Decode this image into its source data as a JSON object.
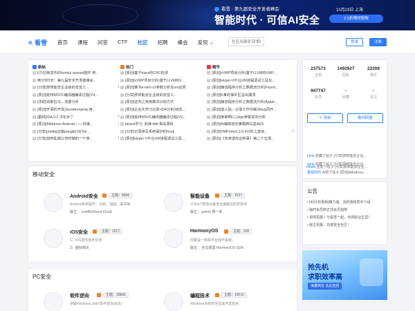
{
  "banner": {
    "event": "看雪 · 第九届安全开发者峰会",
    "slogan": "智能时代 · 可信AI安全",
    "date": "10月23日 上海",
    "cta": "2.5折限时抢购"
  },
  "nav": {
    "logo": "看雪",
    "items": [
      "首页",
      "课程",
      "问答",
      "CTF",
      "社区",
      "招聘",
      "峰会",
      "发现"
    ],
    "active": "社区",
    "search_placeholder": "社区关键词 回车",
    "login": "登录",
    "register": "注册"
  },
  "hot": {
    "columns": [
      {
        "title": "新帖",
        "icon_color": "#2d7cf3",
        "rows": [
          {
            "text": "[讨论]我发布的hookui xposed插件 用...",
            "count": ""
          },
          {
            "text": "倒计时5天！第九届安全开发者峰会...",
            "count": ""
          },
          {
            "text": "[分享]邪修能去企业级的去签工...",
            "count": "1"
          },
          {
            "text": "[原创]劫持MSVC编译器编译过程(VS...",
            "count": ""
          },
          {
            "text": "[求助]哥斯拉马，流量分析",
            "count": ""
          },
          {
            "text": "[原创]开源的开发]JavaHumanity.用...",
            "count": ""
          },
          {
            "text": "[翻译]IDA 9.2 汉化补丁",
            "count": "5"
          },
          {
            "text": "[原创]Albatross Android ——快速...",
            "count": "1"
          },
          {
            "text": "[分享]unidbg企鹅pangle(TikTok ...",
            "count": ""
          },
          {
            "text": "[分享]如何乱搞公司时做的一个简...",
            "count": "1"
          }
        ]
      },
      {
        "title": "热门",
        "icon_color": "#f0802a",
        "rows": [
          {
            "text": "[原创]基于trace的CRC检测",
            "count": ""
          },
          {
            "text": "[原创]xVMP项目分析(基于LLVM的V...",
            "count": ""
          },
          {
            "text": "[原创]某书x-mini-s1参数分析及vm还原",
            "count": ""
          },
          {
            "text": "[分享]邪修能去企业级的去签工...",
            "count": ""
          },
          {
            "text": "[原创]逆向之常用算法识别方式",
            "count": ""
          },
          {
            "text": "[原创]企业化学习记录-IDA分析(动态...",
            "count": ""
          },
          {
            "text": "[原创]劫持MSVC编译器编译过程(VS...",
            "count": ""
          },
          {
            "text": "ptrace学习: 阅读 lldb 相关源码",
            "count": ""
          },
          {
            "text": "[分享]记录常见系统保护的hook",
            "count": ""
          },
          {
            "text": "[原创]Hyper-V平台UM进程调试工具...",
            "count": ""
          }
        ]
      },
      {
        "title": "精华",
        "icon_color": "#e23b3b",
        "rows": [
          {
            "text": "[原创]xVMP项目分析(基于LLVM的VMP...",
            "count": ""
          },
          {
            "text": "[原创]Hyper-V平台UM进程调试工具及...",
            "count": ""
          },
          {
            "text": "[原创]静态程序分析之数据流分析(Found...",
            "count": ""
          },
          {
            "text": "[原创]K某的保护区溢出漏洞",
            "count": ""
          },
          {
            "text": "[原创]静态程序分析之数据流分析(Applic...",
            "count": ""
          },
          {
            "text": "[原创]雷入贴：记录工作中解决bug而开...",
            "count": ""
          },
          {
            "text": "[原创]某聊啊(二)sign参数逆向分析",
            "count": ""
          },
          {
            "text": "[原创]AI辅助逆向某勒牌白盒AES",
            "count": ""
          },
          {
            "text": "[原创]VMProtect 3.9.4分析之虚拟...",
            "count": "2"
          },
          {
            "text": "[原创]《安卓逆向这档事》第二十五课...",
            "count": ""
          }
        ]
      }
    ]
  },
  "mobile": {
    "title": "移动安全",
    "forums": [
      {
        "name": "Android安全",
        "topics": "主题：8596",
        "desc": "Android系统提升、对抗、加固、漏洞等",
        "mods": "版主： LowRebSwrd   Cloud"
      },
      {
        "name": "智能设备",
        "topics": "主题：1537",
        "desc": "讨论IoT智能设备安全威胁及防护技术",
        "mods": "版主： gztem   明一米"
      },
      {
        "name": "iOS安全",
        "topics": "主题：1517",
        "desc": "1）iOS逆向技术交流",
        "desc2": "2）越狱相关",
        "mods": ""
      },
      {
        "name": "HarmonyOS",
        "topics": "主题：200",
        "desc": "鸿蒙是一款跨平台操作系统。",
        "mods": "版主： 全白翠国   HarmonyOS SDK"
      }
    ]
  },
  "pc": {
    "title": "PC安全",
    "forums": [
      {
        "name": "软件逆向",
        "topics": "主题：35886",
        "desc": "讲解Windows,UNIX软件逆向出坑！"
      },
      {
        "name": "编程技术",
        "topics": "主题：19510",
        "desc": "Windows内核安全及其开发技术"
      }
    ]
  },
  "sidebar": {
    "stats": [
      {
        "value": "237573",
        "label": "主题"
      },
      {
        "value": "1492927",
        "label": "回帖"
      },
      {
        "value": "22308",
        "label": "精华"
      },
      {
        "value": "947747",
        "label": "会员"
      },
      {
        "value": "-",
        "label": "收藏"
      },
      {
        "value": "-",
        "label": "关注"
      }
    ],
    "post_button": "发帖",
    "reply_button": "看到回复",
    "activity": [
      {
        "user": "byhk",
        "text": "收藏了帖子 [分享]邪修能去企业..."
      },
      {
        "user": "byhk",
        "text": "收藏了帖子 [分享]邪修能去企业..."
      },
      {
        "user": "重视你的",
        "text": "点赞了帖子 [原创]Albatross ..."
      },
      {
        "user": "hlpidk",
        "text": "回复了帖子 [分享]邪修能去企业..."
      }
    ],
    "notice_title": "公告",
    "notices": [
      "[4月2日更新]魏力值、活跃值和雪币介绍",
      "临时会员转正式会员指南",
      "讲师招募丨与看雪一起，点亮职业生涯！",
      "版主招募，共建安全社区！"
    ],
    "ad": {
      "line1": "抢先机",
      "line2": "求职效率高",
      "line3": "海量岗位  名企直招"
    }
  }
}
